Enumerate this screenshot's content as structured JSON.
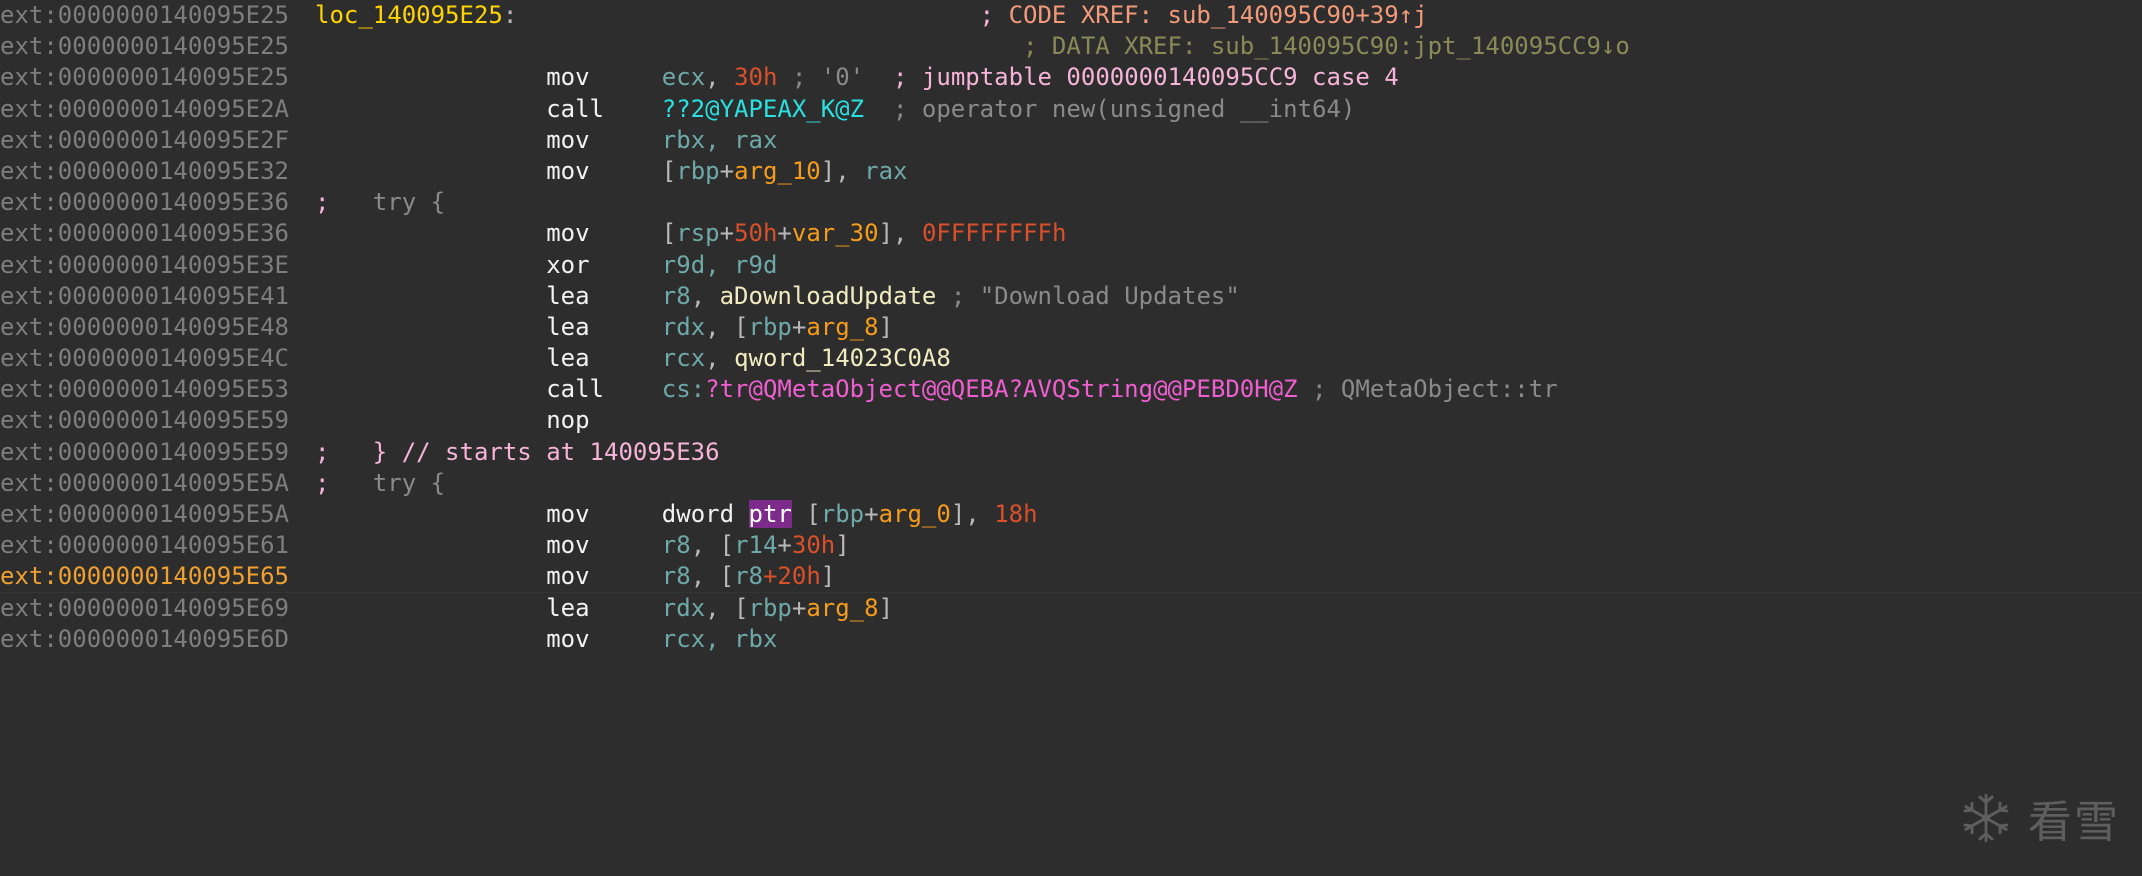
{
  "app": {
    "name": "IDA Pro disassembly listing",
    "segment_prefix": "ext:",
    "theme_background": "#2d2d2d",
    "watermark": {
      "text": "看雪",
      "icon": "snowflake-icon"
    }
  },
  "colors": {
    "address": "#7e7e7e",
    "address_current": "#f0a030",
    "mnemonic": "#f2f2f2",
    "register": "#6fa8a8",
    "immediate": "#d9502a",
    "stack_var": "#f59c1a",
    "label": "#ffd400",
    "data_name": "#f0ecc0",
    "api_name": "#2ae0e0",
    "mangled_symbol": "#ef5fd0",
    "comment": "#8a8a8a",
    "auto_comment": "#f6b5d8",
    "code_xref": "#f29a7a",
    "data_xref": "#8a8a58",
    "selection_highlight": "#7c2b8a"
  },
  "lines": [
    {
      "address": "ext:0000000140095E25",
      "current": false,
      "tokens": [
        {
          "t": "lbl",
          "v": "loc_140095E25"
        },
        {
          "t": "punct",
          "v": ":"
        },
        {
          "t": "pad",
          "v": "                                "
        },
        {
          "t": "semi",
          "v": ";"
        },
        {
          "t": "xref",
          "v": " CODE XREF: sub_140095C90+39↑j"
        }
      ]
    },
    {
      "address": "ext:0000000140095E25",
      "current": false,
      "tokens": [
        {
          "t": "pad",
          "v": "                                                 "
        },
        {
          "t": "xrefd",
          "v": "; DATA XREF: sub_140095C90:jpt_140095CC9↓o"
        }
      ]
    },
    {
      "address": "ext:0000000140095E25",
      "current": false,
      "tokens": [
        {
          "t": "pad",
          "v": "                "
        },
        {
          "t": "mn",
          "v": "mov"
        },
        {
          "t": "pad",
          "v": "     "
        },
        {
          "t": "reg",
          "v": "ecx"
        },
        {
          "t": "punct",
          "v": ", "
        },
        {
          "t": "num",
          "v": "30h"
        },
        {
          "t": "cmt",
          "v": " ; '0'"
        },
        {
          "t": "pad",
          "v": "  "
        },
        {
          "t": "cmtp",
          "v": "; jumptable 0000000140095CC9 case 4"
        }
      ]
    },
    {
      "address": "ext:0000000140095E2A",
      "current": false,
      "tokens": [
        {
          "t": "pad",
          "v": "                "
        },
        {
          "t": "mn",
          "v": "call"
        },
        {
          "t": "pad",
          "v": "    "
        },
        {
          "t": "api",
          "v": "??2@YAPEAX_K@Z"
        },
        {
          "t": "pad",
          "v": "  "
        },
        {
          "t": "cmt",
          "v": "; operator new(unsigned __int64)"
        }
      ]
    },
    {
      "address": "ext:0000000140095E2F",
      "current": false,
      "tokens": [
        {
          "t": "pad",
          "v": "                "
        },
        {
          "t": "mn",
          "v": "mov"
        },
        {
          "t": "pad",
          "v": "     "
        },
        {
          "t": "reg",
          "v": "rbx, rax"
        }
      ]
    },
    {
      "address": "ext:0000000140095E32",
      "current": false,
      "tokens": [
        {
          "t": "pad",
          "v": "                "
        },
        {
          "t": "mn",
          "v": "mov"
        },
        {
          "t": "pad",
          "v": "     "
        },
        {
          "t": "punct",
          "v": "["
        },
        {
          "t": "reg",
          "v": "rbp"
        },
        {
          "t": "punct",
          "v": "+"
        },
        {
          "t": "var",
          "v": "arg_10"
        },
        {
          "t": "punct",
          "v": "], "
        },
        {
          "t": "reg",
          "v": "rax"
        }
      ]
    },
    {
      "address": "ext:0000000140095E36",
      "current": false,
      "tokens": [
        {
          "t": "semi",
          "v": ";"
        },
        {
          "t": "cmt",
          "v": "   try {"
        }
      ]
    },
    {
      "address": "ext:0000000140095E36",
      "current": false,
      "tokens": [
        {
          "t": "pad",
          "v": "                "
        },
        {
          "t": "mn",
          "v": "mov"
        },
        {
          "t": "pad",
          "v": "     "
        },
        {
          "t": "punct",
          "v": "["
        },
        {
          "t": "reg",
          "v": "rsp"
        },
        {
          "t": "punct",
          "v": "+"
        },
        {
          "t": "num",
          "v": "50h"
        },
        {
          "t": "punct",
          "v": "+"
        },
        {
          "t": "var",
          "v": "var_30"
        },
        {
          "t": "punct",
          "v": "], "
        },
        {
          "t": "num",
          "v": "0FFFFFFFFh"
        }
      ]
    },
    {
      "address": "ext:0000000140095E3E",
      "current": false,
      "tokens": [
        {
          "t": "pad",
          "v": "                "
        },
        {
          "t": "mn",
          "v": "xor"
        },
        {
          "t": "pad",
          "v": "     "
        },
        {
          "t": "reg",
          "v": "r9d, r9d"
        }
      ]
    },
    {
      "address": "ext:0000000140095E41",
      "current": false,
      "tokens": [
        {
          "t": "pad",
          "v": "                "
        },
        {
          "t": "mn",
          "v": "lea"
        },
        {
          "t": "pad",
          "v": "     "
        },
        {
          "t": "reg",
          "v": "r8"
        },
        {
          "t": "punct",
          "v": ", "
        },
        {
          "t": "dname",
          "v": "aDownloadUpdate"
        },
        {
          "t": "pad",
          "v": " "
        },
        {
          "t": "cmt",
          "v": "; \"Download Updates\""
        }
      ]
    },
    {
      "address": "ext:0000000140095E48",
      "current": false,
      "tokens": [
        {
          "t": "pad",
          "v": "                "
        },
        {
          "t": "mn",
          "v": "lea"
        },
        {
          "t": "pad",
          "v": "     "
        },
        {
          "t": "reg",
          "v": "rdx"
        },
        {
          "t": "punct",
          "v": ", ["
        },
        {
          "t": "reg",
          "v": "rbp"
        },
        {
          "t": "punct",
          "v": "+"
        },
        {
          "t": "var",
          "v": "arg_8"
        },
        {
          "t": "punct",
          "v": "]"
        }
      ]
    },
    {
      "address": "ext:0000000140095E4C",
      "current": false,
      "tokens": [
        {
          "t": "pad",
          "v": "                "
        },
        {
          "t": "mn",
          "v": "lea"
        },
        {
          "t": "pad",
          "v": "     "
        },
        {
          "t": "reg",
          "v": "rcx"
        },
        {
          "t": "punct",
          "v": ", "
        },
        {
          "t": "dname",
          "v": "qword_14023C0A8"
        }
      ]
    },
    {
      "address": "ext:0000000140095E53",
      "current": false,
      "tokens": [
        {
          "t": "pad",
          "v": "                "
        },
        {
          "t": "mn",
          "v": "call"
        },
        {
          "t": "pad",
          "v": "    "
        },
        {
          "t": "reg",
          "v": "cs:"
        },
        {
          "t": "mang",
          "v": "?tr@QMetaObject@@QEBA?AVQString@@PEBD0H@Z"
        },
        {
          "t": "pad",
          "v": " "
        },
        {
          "t": "cmt",
          "v": "; QMetaObject::tr"
        }
      ]
    },
    {
      "address": "ext:0000000140095E59",
      "current": false,
      "tokens": [
        {
          "t": "pad",
          "v": "                "
        },
        {
          "t": "mn",
          "v": "nop"
        }
      ]
    },
    {
      "address": "ext:0000000140095E59",
      "current": false,
      "tokens": [
        {
          "t": "semi",
          "v": ";"
        },
        {
          "t": "cmtp",
          "v": "   } // starts at 140095E36"
        }
      ]
    },
    {
      "address": "ext:0000000140095E5A",
      "current": false,
      "tokens": [
        {
          "t": "semi",
          "v": ";"
        },
        {
          "t": "cmt",
          "v": "   try {"
        }
      ]
    },
    {
      "address": "ext:0000000140095E5A",
      "current": false,
      "tokens": [
        {
          "t": "pad",
          "v": "                "
        },
        {
          "t": "mn",
          "v": "mov"
        },
        {
          "t": "pad",
          "v": "     "
        },
        {
          "t": "mn",
          "v": "dword "
        },
        {
          "t": "hl",
          "v": "ptr"
        },
        {
          "t": "punct",
          "v": " ["
        },
        {
          "t": "reg",
          "v": "rbp"
        },
        {
          "t": "punct",
          "v": "+"
        },
        {
          "t": "var",
          "v": "arg_0"
        },
        {
          "t": "punct",
          "v": "], "
        },
        {
          "t": "num",
          "v": "18h"
        }
      ]
    },
    {
      "address": "ext:0000000140095E61",
      "current": false,
      "tokens": [
        {
          "t": "pad",
          "v": "                "
        },
        {
          "t": "mn",
          "v": "mov"
        },
        {
          "t": "pad",
          "v": "     "
        },
        {
          "t": "reg",
          "v": "r8"
        },
        {
          "t": "punct",
          "v": ", ["
        },
        {
          "t": "reg",
          "v": "r14"
        },
        {
          "t": "punct",
          "v": "+"
        },
        {
          "t": "num",
          "v": "30h"
        },
        {
          "t": "punct",
          "v": "]"
        }
      ]
    },
    {
      "address": "ext:0000000140095E65",
      "current": true,
      "tokens": [
        {
          "t": "pad",
          "v": "                "
        },
        {
          "t": "mn",
          "v": "mov"
        },
        {
          "t": "pad",
          "v": "     "
        },
        {
          "t": "reg",
          "v": "r8"
        },
        {
          "t": "punct",
          "v": ", ["
        },
        {
          "t": "reg",
          "v": "r8"
        },
        {
          "t": "caret",
          "v": "+"
        },
        {
          "t": "num",
          "v": "20h"
        },
        {
          "t": "punct",
          "v": "]"
        }
      ]
    },
    {
      "address": "ext:0000000140095E69",
      "current": false,
      "tokens": [
        {
          "t": "pad",
          "v": "                "
        },
        {
          "t": "mn",
          "v": "lea"
        },
        {
          "t": "pad",
          "v": "     "
        },
        {
          "t": "reg",
          "v": "rdx"
        },
        {
          "t": "punct",
          "v": ", ["
        },
        {
          "t": "reg",
          "v": "rbp"
        },
        {
          "t": "punct",
          "v": "+"
        },
        {
          "t": "var",
          "v": "arg_8"
        },
        {
          "t": "punct",
          "v": "]"
        }
      ]
    },
    {
      "address": "ext:0000000140095E6D",
      "current": false,
      "tokens": [
        {
          "t": "pad",
          "v": "                "
        },
        {
          "t": "mn",
          "v": "mov"
        },
        {
          "t": "pad",
          "v": "     "
        },
        {
          "t": "reg",
          "v": "rcx, rbx"
        }
      ]
    }
  ]
}
